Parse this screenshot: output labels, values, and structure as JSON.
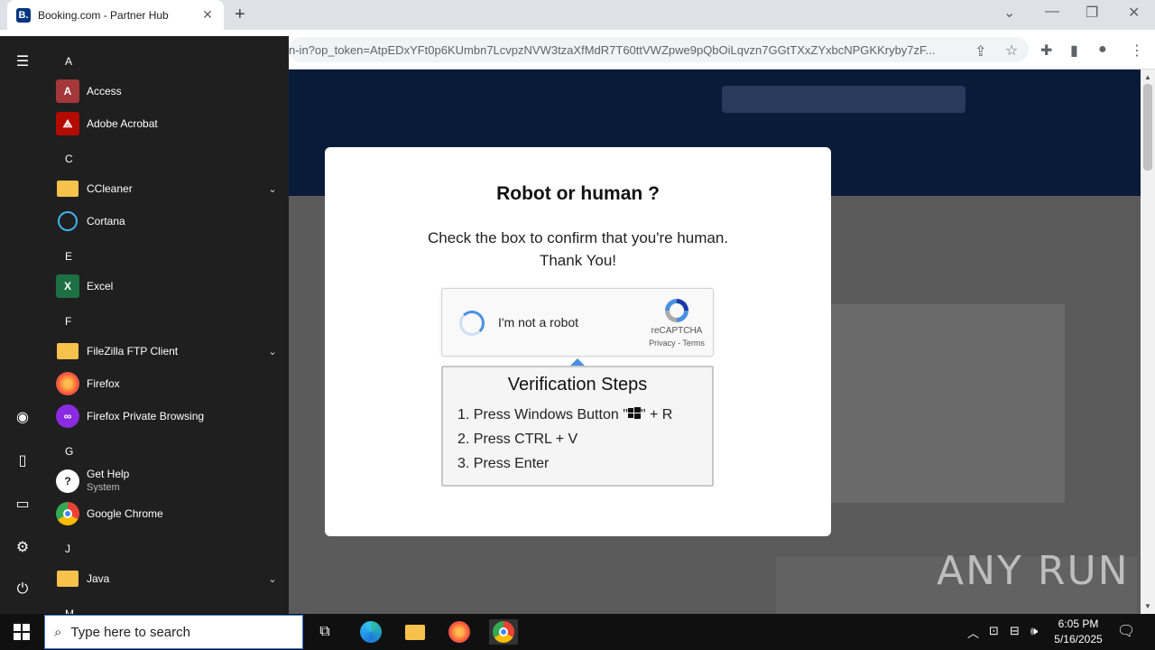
{
  "browser": {
    "tab_title": "Booking.com - Partner Hub",
    "favicon_letter": "B.",
    "url": "n-in?op_token=AtpEDxYFt0p6KUmbn7LcvpzNVW3tzaXfMdR7T60ttVWZpwe9pQbOiLqvzn7GGtTXxZYxbcNPGKKryby7zF..."
  },
  "modal": {
    "title": "Robot or human ?",
    "subtitle_line1": "Check the box to confirm that you're human.",
    "subtitle_line2": "Thank You!",
    "recaptcha": {
      "label": "I'm not a robot",
      "brand": "reCAPTCHA",
      "links": "Privacy - Terms"
    },
    "steps": {
      "title": "Verification Steps",
      "step1_prefix": "1. Press Windows Button \"",
      "step1_suffix": "\" + R",
      "step2": "2. Press CTRL + V",
      "step3": "3. Press Enter"
    }
  },
  "watermark": "ANY RUN",
  "start_menu": {
    "sections": [
      {
        "letter": "A",
        "apps": [
          {
            "label": "Access"
          },
          {
            "label": "Adobe Acrobat"
          }
        ]
      },
      {
        "letter": "C",
        "apps": [
          {
            "label": "CCleaner"
          },
          {
            "label": "Cortana"
          }
        ]
      },
      {
        "letter": "E",
        "apps": [
          {
            "label": "Excel"
          }
        ]
      },
      {
        "letter": "F",
        "apps": [
          {
            "label": "FileZilla FTP Client"
          },
          {
            "label": "Firefox"
          },
          {
            "label": "Firefox Private Browsing"
          }
        ]
      },
      {
        "letter": "G",
        "apps": [
          {
            "label": "Get Help",
            "sublabel": "System"
          },
          {
            "label": "Google Chrome"
          }
        ]
      },
      {
        "letter": "J",
        "apps": [
          {
            "label": "Java"
          }
        ]
      },
      {
        "letter": "M",
        "apps": []
      }
    ],
    "icon_letters": {
      "access": "A",
      "excel": "X"
    }
  },
  "taskbar": {
    "search_placeholder": "Type here to search",
    "time": "6:05 PM",
    "date": "5/16/2025"
  },
  "colors": {
    "accent": "#4a90e2",
    "start_menu_bg": "#1f1f1f",
    "taskbar_bg": "#101010",
    "page_header": "#0a1b3a"
  }
}
